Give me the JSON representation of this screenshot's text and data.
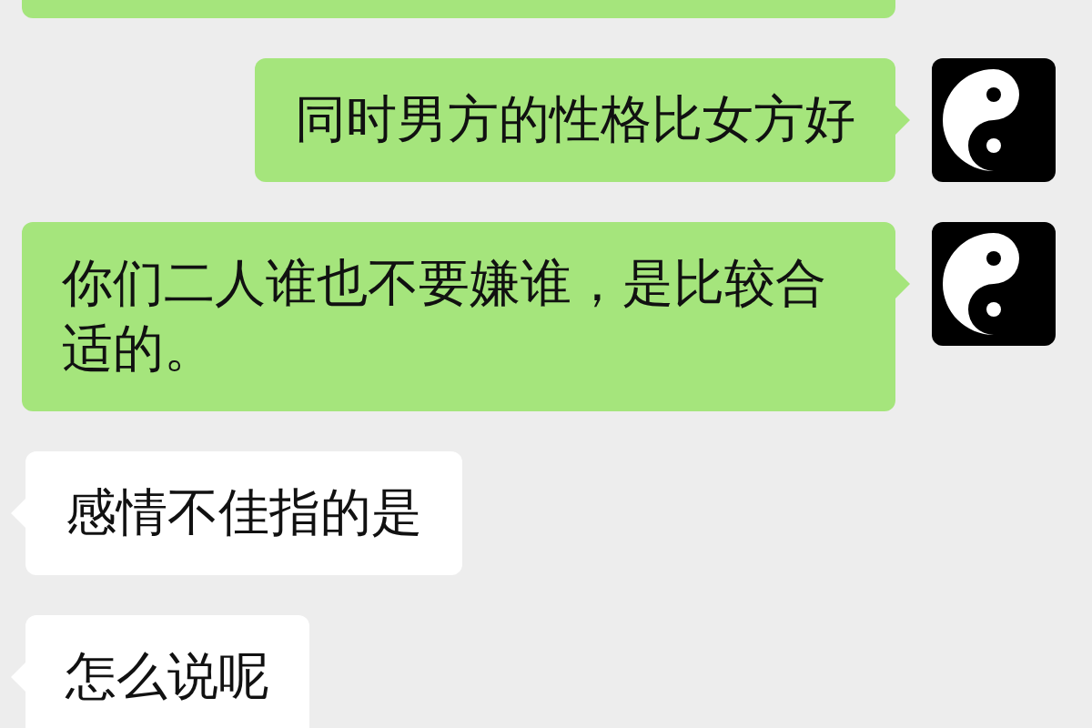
{
  "messages": [
    {
      "kind": "sent",
      "avatar": false
    },
    {
      "kind": "sent",
      "avatar": true,
      "text": "同时男方的性格比女方好"
    },
    {
      "kind": "sent",
      "avatar": true,
      "text": "你们二人谁也不要嫌谁，是比较合适的。"
    },
    {
      "kind": "received",
      "avatar": false,
      "text": "感情不佳指的是"
    },
    {
      "kind": "received",
      "avatar": false,
      "text": "怎么说呢"
    }
  ]
}
